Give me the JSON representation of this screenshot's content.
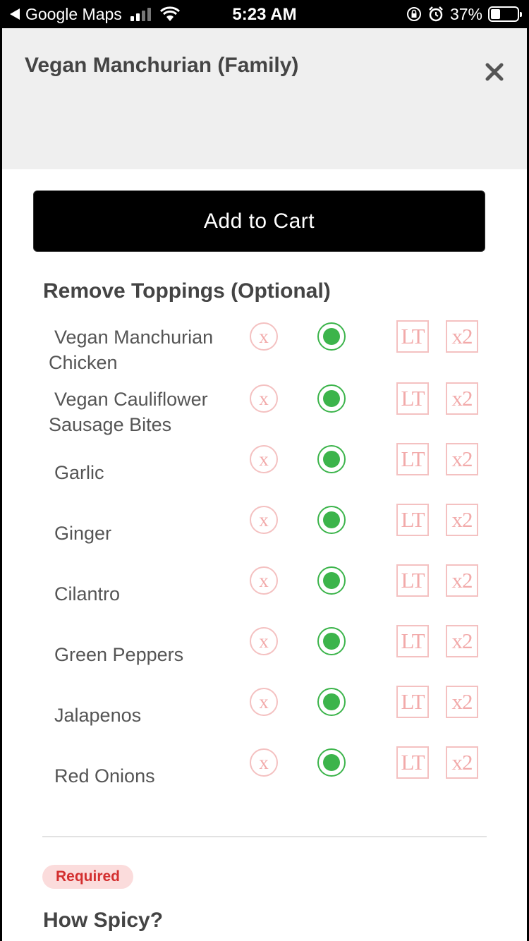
{
  "status_bar": {
    "back_app": "Google Maps",
    "time": "5:23 AM",
    "battery": "37%",
    "battery_level": 0.37
  },
  "modal": {
    "title": "Vegan Manchurian (Family)",
    "close_icon": "close-icon",
    "add_to_cart": "Add to Cart",
    "remove_toppings_title": "Remove Toppings (Optional)",
    "options": {
      "remove": "X",
      "lite": "LT",
      "double": "x2"
    },
    "toppings": [
      {
        "name": "Vegan Manchurian Chicken",
        "selected": "regular"
      },
      {
        "name": "Vegan Cauliflower Sausage Bites",
        "selected": "regular"
      },
      {
        "name": "Garlic",
        "selected": "regular"
      },
      {
        "name": "Ginger",
        "selected": "regular"
      },
      {
        "name": "Cilantro",
        "selected": "regular"
      },
      {
        "name": "Green Peppers",
        "selected": "regular"
      },
      {
        "name": "Jalapenos",
        "selected": "regular"
      },
      {
        "name": "Red Onions",
        "selected": "regular"
      }
    ],
    "required_badge": "Required",
    "spicy_title": "How Spicy?"
  },
  "colors": {
    "selected_green": "#3cb44b",
    "inactive_pink": "#f2aaaa",
    "required_red": "#d32f2f"
  }
}
